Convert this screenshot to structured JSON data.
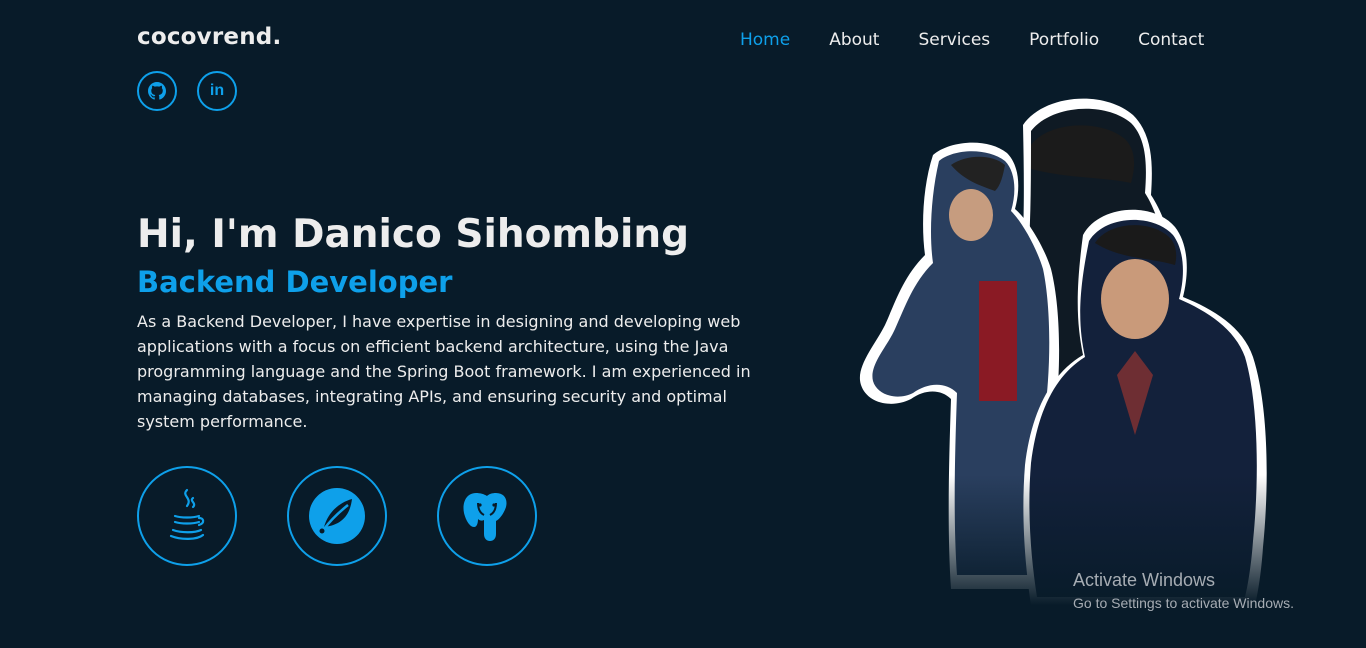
{
  "brand": {
    "logo": "cocovrend."
  },
  "nav": {
    "items": [
      {
        "label": "Home",
        "active": true
      },
      {
        "label": "About",
        "active": false
      },
      {
        "label": "Services",
        "active": false
      },
      {
        "label": "Portfolio",
        "active": false
      },
      {
        "label": "Contact",
        "active": false
      }
    ]
  },
  "social": {
    "github_icon": "github-icon",
    "linkedin_label": "in"
  },
  "hero": {
    "title": "Hi, I'm Danico Sihombing",
    "role": "Backend Developer",
    "description": "As a Backend Developer, I have expertise in designing and developing web applications with a focus on efficient backend architecture, using the Java programming language and the Spring Boot framework. I am experienced in managing databases, integrating APIs, and ensuring security and optimal system performance."
  },
  "tech_icons": [
    "java-icon",
    "spring-icon",
    "postgresql-icon"
  ],
  "watermark": {
    "title": "Activate Windows",
    "subtitle": "Go to Settings to activate Windows."
  },
  "colors": {
    "background": "#081b29",
    "accent": "#0ea0ea",
    "text": "#ededed"
  }
}
